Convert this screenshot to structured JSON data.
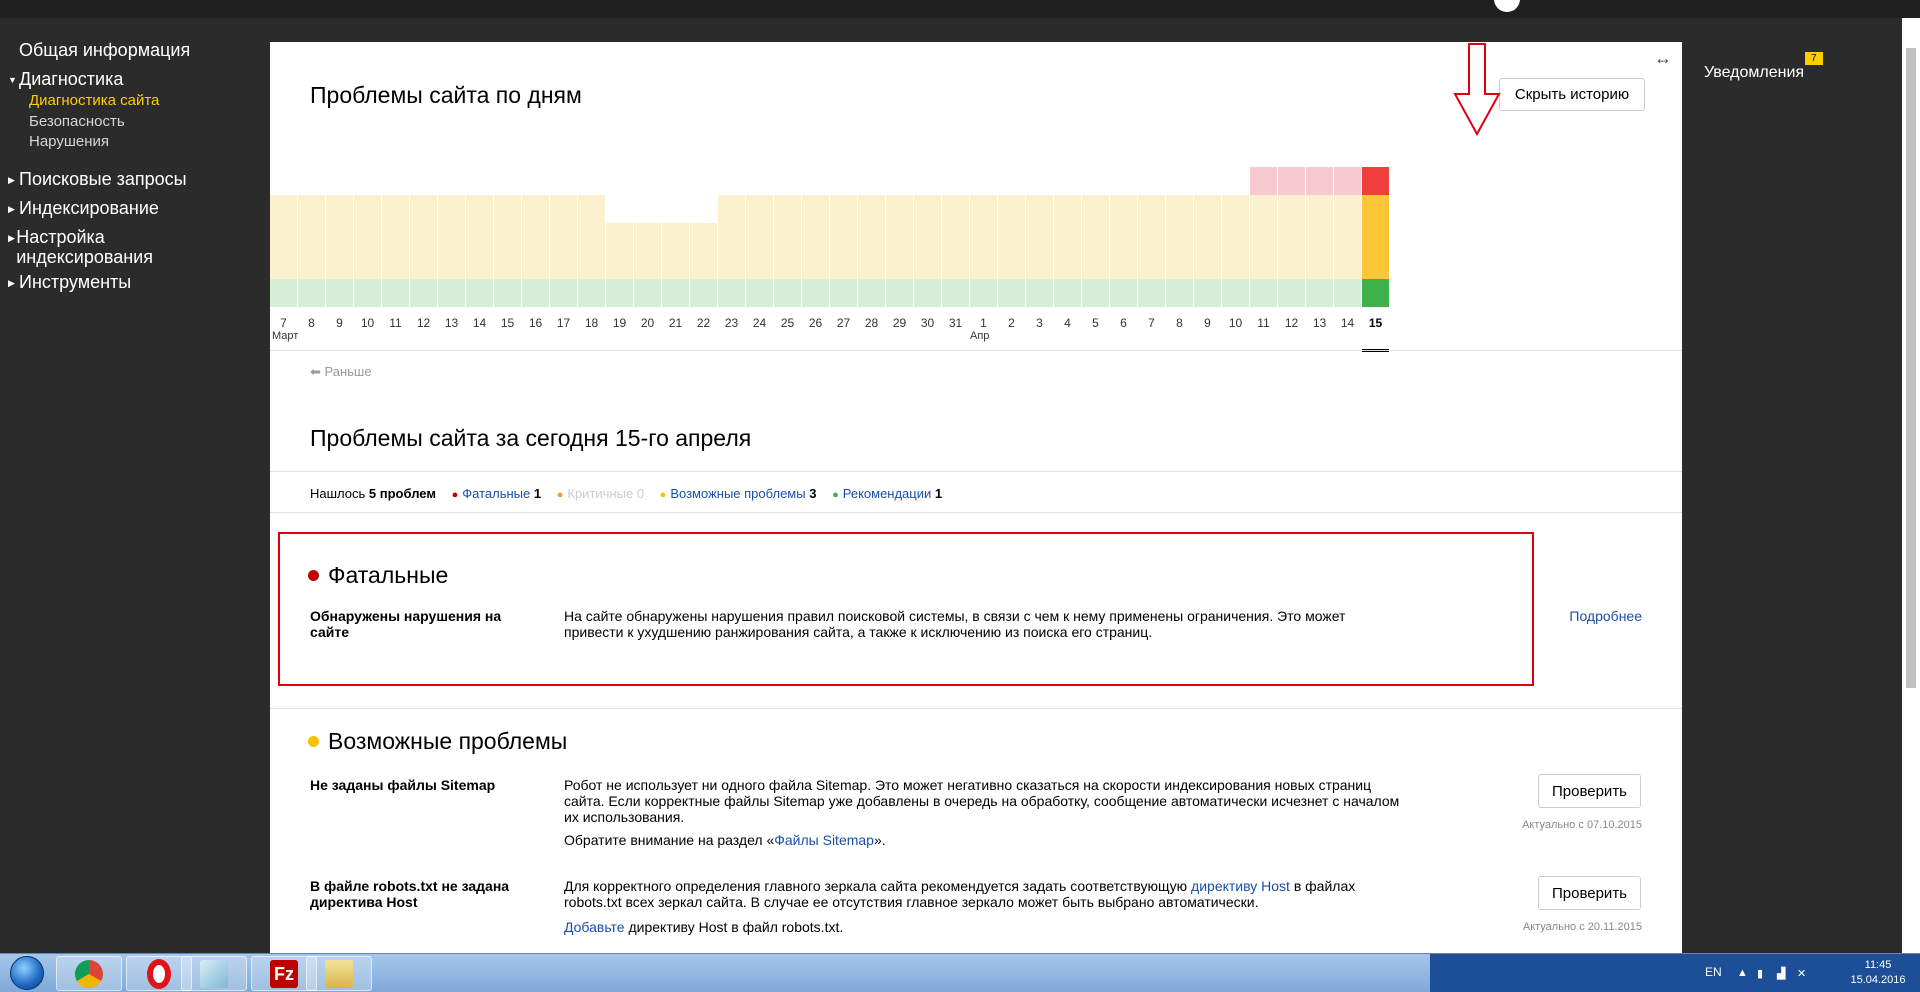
{
  "sidebar": {
    "general": "Общая информация",
    "diagnostics": {
      "label": "Диагностика",
      "items": [
        {
          "label": "Диагностика сайта",
          "active": true
        },
        {
          "label": "Безопасность",
          "active": false
        },
        {
          "label": "Нарушения",
          "active": false
        }
      ]
    },
    "search_queries": "Поисковые запросы",
    "indexing": "Индексирование",
    "index_settings": "Настройка индексирования",
    "tools": "Инструменты"
  },
  "history": {
    "title": "Проблемы сайта по дням",
    "hide_button": "Скрыть историю",
    "earlier": "Раньше",
    "chart_data": {
      "type": "bar",
      "categories": [
        "7",
        "8",
        "9",
        "10",
        "11",
        "12",
        "13",
        "14",
        "15",
        "16",
        "17",
        "18",
        "19",
        "20",
        "21",
        "22",
        "23",
        "24",
        "25",
        "26",
        "27",
        "28",
        "29",
        "30",
        "31",
        "1",
        "2",
        "3",
        "4",
        "5",
        "6",
        "7",
        "8",
        "9",
        "10",
        "11",
        "12",
        "13",
        "14",
        "15"
      ],
      "month_labels": [
        {
          "index": 0,
          "label": "Март"
        },
        {
          "index": 25,
          "label": "Апр"
        }
      ],
      "series": [
        {
          "name": "recommendations",
          "values": [
            1,
            1,
            1,
            1,
            1,
            1,
            1,
            1,
            1,
            1,
            1,
            1,
            1,
            1,
            1,
            1,
            1,
            1,
            1,
            1,
            1,
            1,
            1,
            1,
            1,
            1,
            1,
            1,
            1,
            1,
            1,
            1,
            1,
            1,
            1,
            1,
            1,
            1,
            1,
            1
          ]
        },
        {
          "name": "possible",
          "values": [
            3,
            3,
            3,
            3,
            3,
            3,
            3,
            3,
            3,
            3,
            3,
            3,
            2,
            2,
            2,
            2,
            3,
            3,
            3,
            3,
            3,
            3,
            3,
            3,
            3,
            3,
            3,
            3,
            3,
            3,
            3,
            3,
            3,
            3,
            3,
            3,
            3,
            3,
            3,
            3
          ]
        },
        {
          "name": "fatal",
          "values": [
            0,
            0,
            0,
            0,
            0,
            0,
            0,
            0,
            0,
            0,
            0,
            0,
            0,
            0,
            0,
            0,
            0,
            0,
            0,
            0,
            0,
            0,
            0,
            0,
            0,
            0,
            0,
            0,
            0,
            0,
            0,
            0,
            0,
            0,
            0,
            1,
            1,
            1,
            1,
            1
          ]
        }
      ],
      "selected_index": 39,
      "colors": {
        "fatal": "#f8c9ce",
        "fatal_selected": "#f23d3d",
        "possible": "#fcf1cf",
        "possible_selected": "#fdc639",
        "recommendations": "#d6efd9",
        "recommendations_selected": "#3eb14a"
      }
    }
  },
  "today": {
    "title": "Проблемы сайта за сегодня 15-го апреля",
    "found_prefix": "Нашлось",
    "found_count": "5 проблем",
    "filters": [
      {
        "label": "Фатальные",
        "count": "1",
        "color": "#c00000",
        "enabled": true
      },
      {
        "label": "Критичные",
        "count": "0",
        "color": "#f59c2b",
        "enabled": false
      },
      {
        "label": "Возможные проблемы",
        "count": "3",
        "color": "#f5c400",
        "enabled": true
      },
      {
        "label": "Рекомендации",
        "count": "1",
        "color": "#3eb14a",
        "enabled": true
      }
    ]
  },
  "fatal_group": {
    "title": "Фатальные",
    "color": "#c00000",
    "issue": {
      "name": "Обнаружены нарушения на сайте",
      "desc": "На сайте обнаружены нарушения правил поисковой системы, в связи с чем к нему применены ограничения. Это может привести к ухудшению ранжирования сайта, а также к исключению из поиска его страниц.",
      "link": "Подробнее"
    }
  },
  "possible_group": {
    "title": "Возможные проблемы",
    "color": "#f5c400",
    "issues": [
      {
        "name": "Не заданы файлы Sitemap",
        "desc": "Робот не использует ни одного файла Sitemap. Это может негативно сказаться на скорости индексирования новых страниц сайта. Если корректные файлы Sitemap уже добавлены в очередь на обработку, сообщение автоматически исчезнет с началом их использования.",
        "note_prefix": "Обратите внимание на раздел «",
        "note_link": "Файлы Sitemap",
        "note_suffix": "».",
        "button": "Проверить",
        "actual": "Актуально с 07.10.2015"
      },
      {
        "name": "В файле robots.txt не задана директива Host",
        "desc_prefix": "Для корректного определения главного зеркала сайта рекомендуется задать соответствующую ",
        "desc_link": "директиву Host",
        "desc_suffix": " в файлах robots.txt всех зеркал сайта. В случае ее отсутствия главное зеркало может быть выбрано автоматически.",
        "note_link": "Добавьте",
        "note_suffix": " директиву Host в файл robots.txt.",
        "button": "Проверить",
        "actual": "Актуально с 20.11.2015"
      }
    ]
  },
  "notifications": {
    "label": "Уведомления",
    "count": "7"
  },
  "taskbar": {
    "lang": "EN",
    "time": "11:45",
    "date": "15.04.2016",
    "apps": [
      "chrome-icon",
      "opera-icon",
      "notepad-icon",
      "filezilla-icon",
      "explorer-icon"
    ]
  }
}
